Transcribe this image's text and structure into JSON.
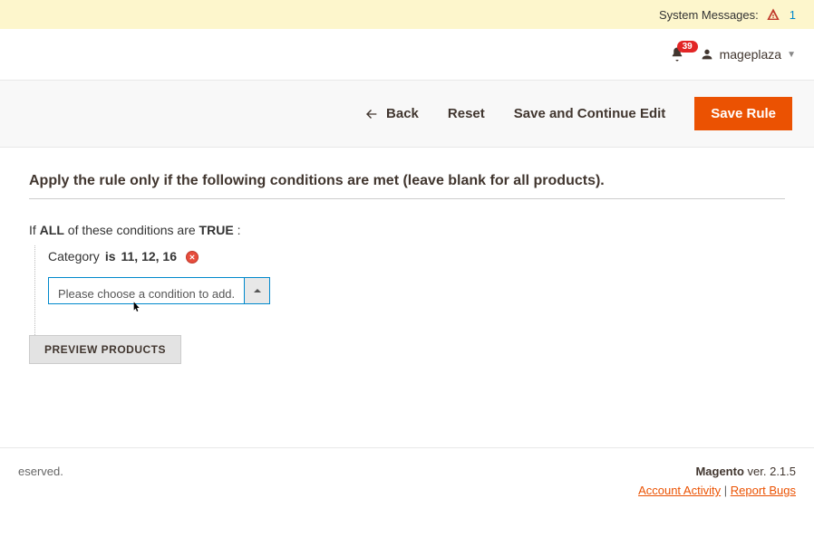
{
  "system_messages": {
    "label": "System Messages:",
    "count": "1"
  },
  "notifications": {
    "badge": "39"
  },
  "user": {
    "name": "mageplaza"
  },
  "actions": {
    "back": "Back",
    "reset": "Reset",
    "save_continue": "Save and Continue Edit",
    "save_rule": "Save Rule"
  },
  "section": {
    "title": "Apply the rule only if the following conditions are met (leave blank for all products).",
    "cond_text": {
      "if": "If",
      "aggregator": "ALL",
      "of": " of these conditions are",
      "value": "TRUE",
      "colon": ":"
    },
    "condition": {
      "attribute": "Category",
      "operator": "is",
      "value": "11, 12, 16"
    },
    "add_placeholder": "Please choose a condition to add.",
    "preview_btn": "PREVIEW PRODUCTS"
  },
  "footer": {
    "left": "eserved.",
    "brand": "Magento",
    "version": " ver. 2.1.5",
    "account_activity": "Account Activity",
    "report_bugs": "Report Bugs"
  }
}
